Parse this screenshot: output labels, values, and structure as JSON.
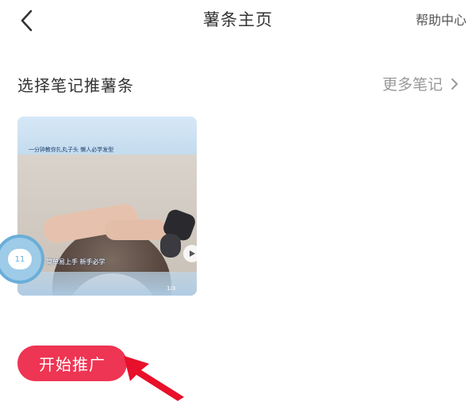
{
  "navbar": {
    "title": "薯条主页",
    "help_label": "帮助中心",
    "back_icon": "chevron-left-icon"
  },
  "section": {
    "title": "选择笔记推薯条",
    "more_label": "更多笔记",
    "more_icon": "chevron-right-icon"
  },
  "note_card": {
    "caption_top": "一分钟教你扎丸子头 懒人必学发型",
    "caption_bottom": "简单易上手 新手必学",
    "play_icon": "play-icon",
    "page_indicator": "1/3"
  },
  "float_bubble": {
    "icon": "chat-bubble-icon",
    "label": "11"
  },
  "actions": {
    "start_label": "开始推广"
  },
  "colors": {
    "accent": "#ee3553",
    "arrow": "#e8102a",
    "muted_text": "#999999"
  }
}
